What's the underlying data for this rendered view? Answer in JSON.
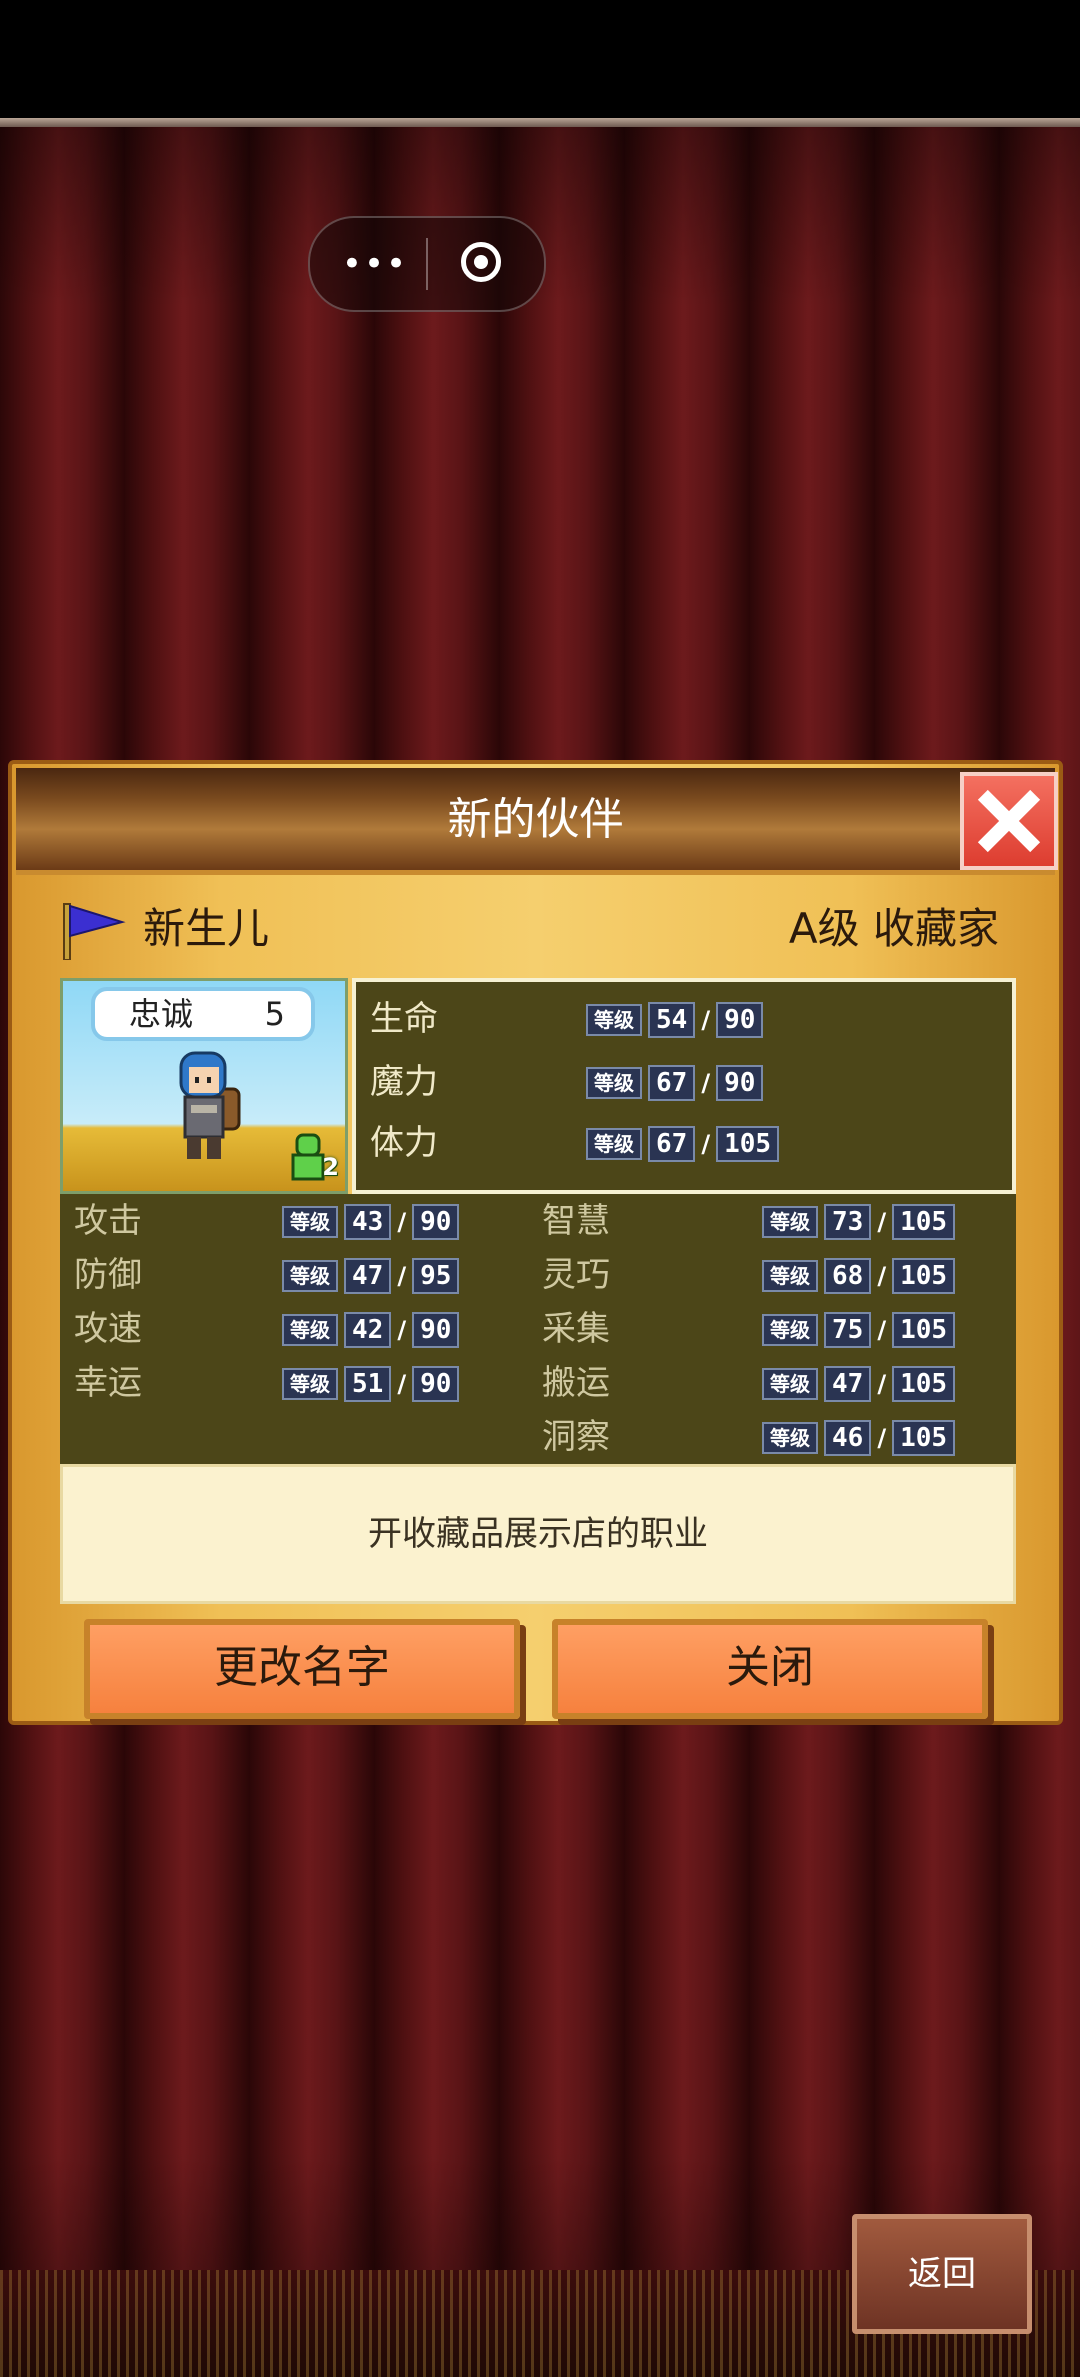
{
  "colors": {
    "curtain": "#5a1416",
    "dialog": "#f0c056",
    "title_bar": "#7a4a1e",
    "stat_panel": "#4c4618",
    "button": "#f6813e",
    "close": "#dd3d30"
  },
  "capsule": {
    "more_icon": "more-dots-icon",
    "target_icon": "target-icon"
  },
  "dialog": {
    "title": "新的伙伴",
    "close_icon": "close-x-icon",
    "character": {
      "name": "新生儿",
      "rank": "A级 收藏家",
      "loyalty_label": "忠诚",
      "loyalty_value": "5",
      "team_badge": "2"
    },
    "level_tag": "等级",
    "vitals": [
      {
        "label": "生命",
        "current": "54",
        "max": "90"
      },
      {
        "label": "魔力",
        "current": "67",
        "max": "90"
      },
      {
        "label": "体力",
        "current": "67",
        "max": "105"
      }
    ],
    "stats_left": [
      {
        "label": "攻击",
        "current": "43",
        "max": "90"
      },
      {
        "label": "防御",
        "current": "47",
        "max": "95"
      },
      {
        "label": "攻速",
        "current": "42",
        "max": "90"
      },
      {
        "label": "幸运",
        "current": "51",
        "max": "90"
      }
    ],
    "stats_right": [
      {
        "label": "智慧",
        "current": "73",
        "max": "105"
      },
      {
        "label": "灵巧",
        "current": "68",
        "max": "105"
      },
      {
        "label": "采集",
        "current": "75",
        "max": "105"
      },
      {
        "label": "搬运",
        "current": "47",
        "max": "105"
      },
      {
        "label": "洞察",
        "current": "46",
        "max": "105"
      }
    ],
    "description": "开收藏品展示店的职业",
    "rename_button": "更改名字",
    "close_button": "关闭"
  },
  "back_button": "返回"
}
